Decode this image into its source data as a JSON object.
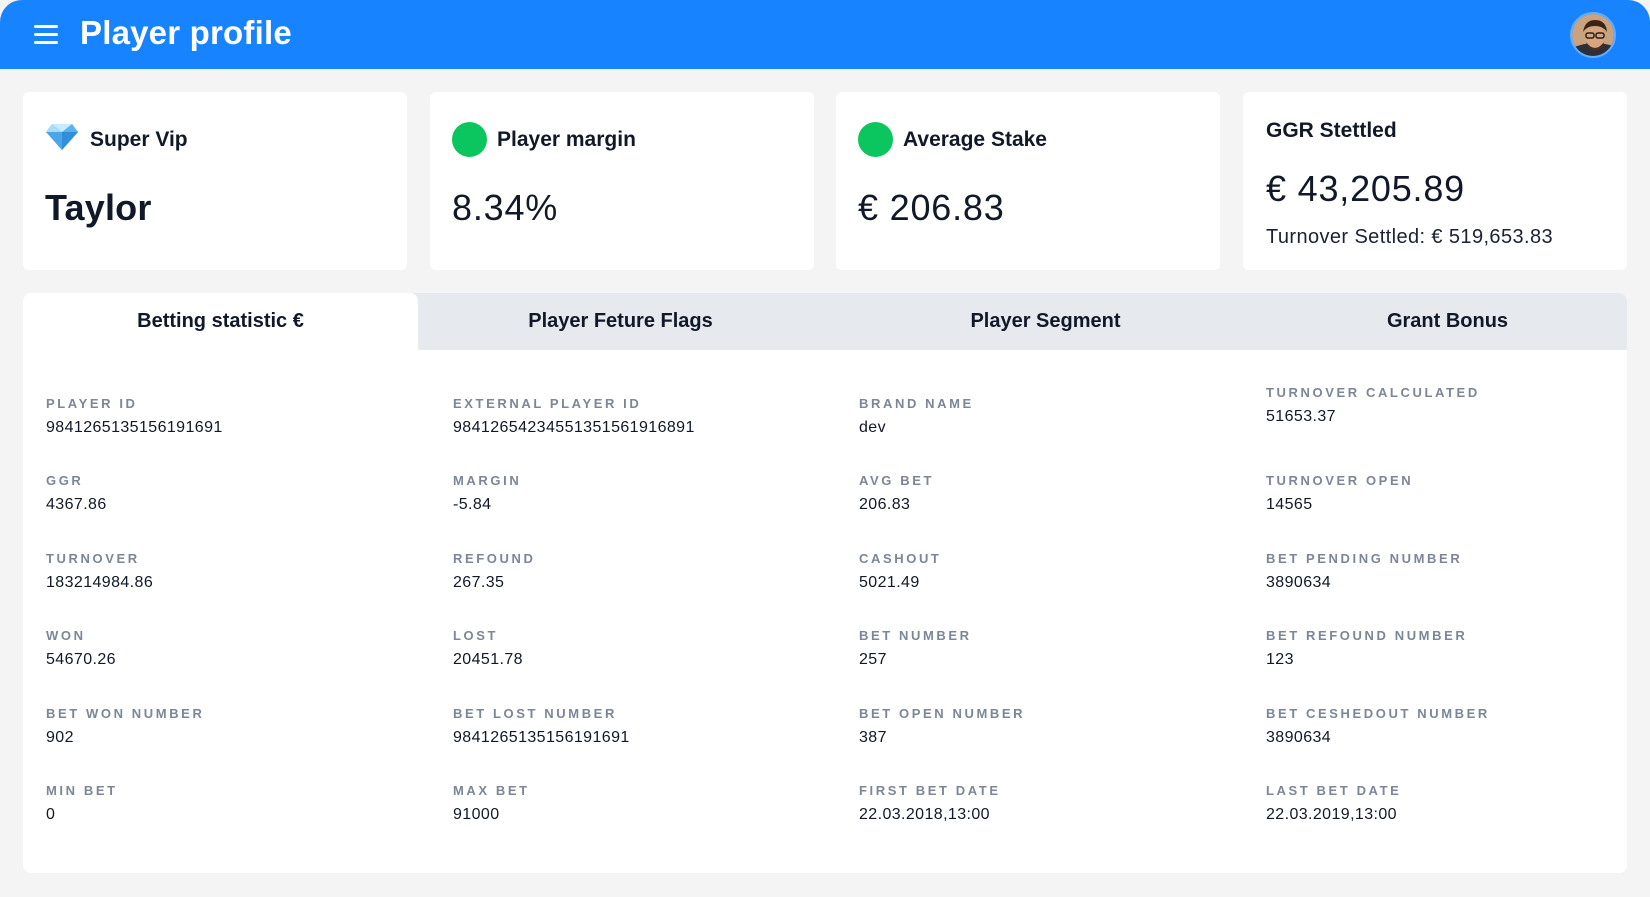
{
  "header": {
    "title": "Player profile",
    "menu_icon": "hamburger-menu-icon",
    "avatar_icon": "user-avatar"
  },
  "cards": [
    {
      "label": "Super Vip",
      "value": "Taylor",
      "icon": "diamond-icon"
    },
    {
      "label": "Player margin",
      "value": "8.34%",
      "indicator_color": "#0bc65e"
    },
    {
      "label": "Average Stake",
      "value": "€ 206.83",
      "indicator_color": "#0bc65e"
    },
    {
      "label": "GGR Stettled",
      "value": "€ 43,205.89",
      "sub": "Turnover Settled: € 519,653.83"
    }
  ],
  "tabs": [
    {
      "label": "Betting statistic €",
      "active": true
    },
    {
      "label": "Player Feture Flags",
      "active": false
    },
    {
      "label": "Player Segment",
      "active": false
    },
    {
      "label": "Grant Bonus",
      "active": false
    }
  ],
  "columns": [
    [
      {
        "label": "Player ID",
        "value": "9841265135156191691"
      },
      {
        "label": "GGR",
        "value": "4367.86"
      },
      {
        "label": "Turnover",
        "value": "183214984.86"
      },
      {
        "label": "Won",
        "value": "54670.26"
      },
      {
        "label": "Bet won number",
        "value": "902"
      },
      {
        "label": "Min bet",
        "value": "0"
      }
    ],
    [
      {
        "label": "External player ID",
        "value": "98412654234551351561916891"
      },
      {
        "label": "Margin",
        "value": "-5.84"
      },
      {
        "label": "Refound",
        "value": "267.35"
      },
      {
        "label": "Lost",
        "value": "20451.78"
      },
      {
        "label": "Bet lost number",
        "value": "9841265135156191691"
      },
      {
        "label": "Max bet",
        "value": "91000"
      }
    ],
    [
      {
        "label": "Brand name",
        "value": "dev"
      },
      {
        "label": "Avg bet",
        "value": "206.83"
      },
      {
        "label": "Cashout",
        "value": "5021.49"
      },
      {
        "label": "Bet number",
        "value": "257"
      },
      {
        "label": "Bet open number",
        "value": "387"
      },
      {
        "label": "First bet date",
        "value": "22.03.2018,13:00"
      }
    ],
    [
      {
        "label": "Turnover calculated",
        "value": "51653.37"
      },
      {
        "label": "Turnover open",
        "value": "14565"
      },
      {
        "label": "Bet pending number",
        "value": "3890634"
      },
      {
        "label": "Bet refound number",
        "value": "123"
      },
      {
        "label": "Bet ceshedout number",
        "value": "3890634"
      },
      {
        "label": "Last bet date",
        "value": "22.03.2019,13:00"
      }
    ]
  ],
  "colors": {
    "header": "#1883ff",
    "background": "#f5f4f4",
    "indicator": "#0bc65e",
    "label": "#7c8696",
    "tab_inactive": "#e6e9ee"
  }
}
